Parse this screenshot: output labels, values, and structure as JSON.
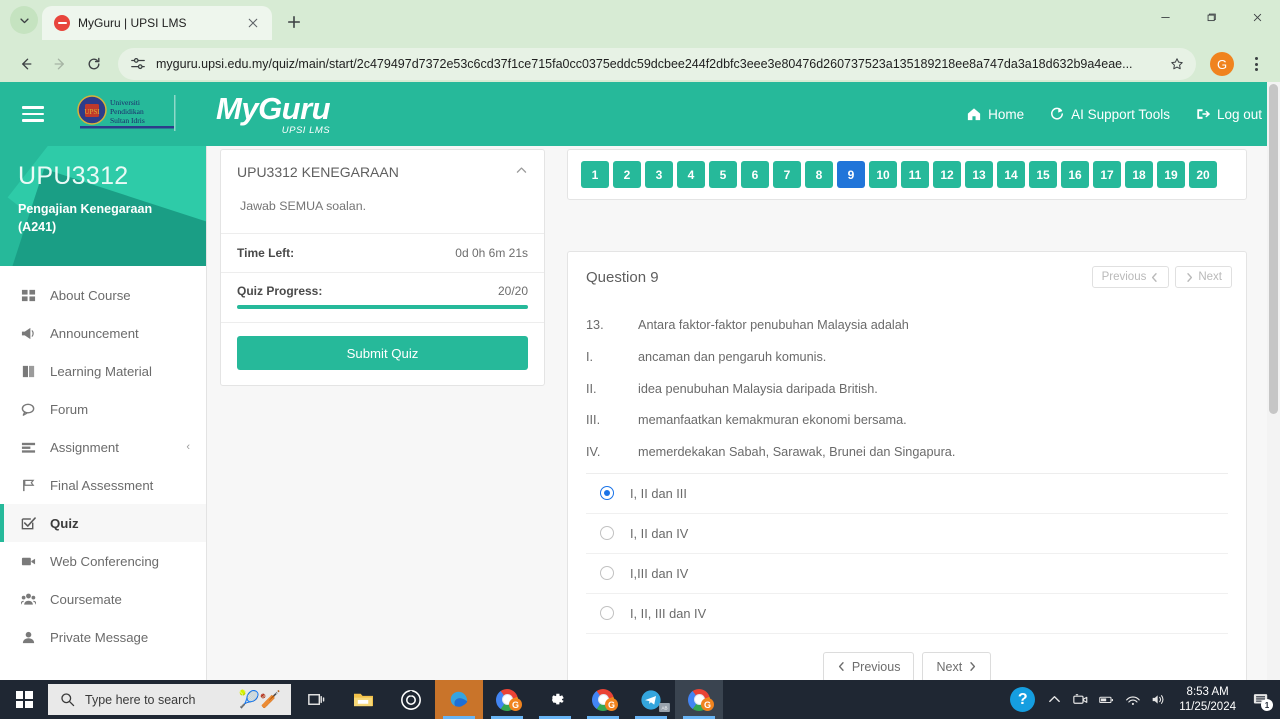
{
  "browser": {
    "tab": {
      "title": "MyGuru | UPSI LMS",
      "favicon": "record-icon"
    },
    "url": "myguru.upsi.edu.my/quiz/main/start/2c479497d7372e53c6cd37f1ce715fa0cc0375eddc59dcbee244f2dbfc3eee3e80476d260737523a135189218ee8a747da3a18d632b9a4eae...",
    "profile_initial": "G",
    "window_controls": {
      "minimize": "minimize-icon",
      "maximize": "restore-icon",
      "close": "close-icon"
    },
    "chrome_bg": "#d7ebd4"
  },
  "topnav": {
    "brand_main": "MyGuru",
    "brand_sub": "UPSI LMS",
    "links": [
      {
        "label": "Home",
        "icon": "home-icon"
      },
      {
        "label": "AI Support Tools",
        "icon": "ai-icon"
      },
      {
        "label": "Log out",
        "icon": "logout-icon"
      }
    ],
    "accent": "#26b99a"
  },
  "sidebar": {
    "course_code": "UPU3312",
    "course_name": "Pengajian Kenegaraan (A241)",
    "items": [
      {
        "label": "About Course",
        "icon": "grid-icon",
        "active": false,
        "caret": ""
      },
      {
        "label": "Announcement",
        "icon": "megaphone-icon",
        "active": false,
        "caret": ""
      },
      {
        "label": "Learning Material",
        "icon": "book-icon",
        "active": false,
        "caret": ""
      },
      {
        "label": "Forum",
        "icon": "chat-icon",
        "active": false,
        "caret": ""
      },
      {
        "label": "Assignment",
        "icon": "list-icon",
        "active": false,
        "caret": "‹"
      },
      {
        "label": "Final Assessment",
        "icon": "flag-icon",
        "active": false,
        "caret": ""
      },
      {
        "label": "Quiz",
        "icon": "checkbox-icon",
        "active": true,
        "caret": ""
      },
      {
        "label": "Web Conferencing",
        "icon": "video-icon",
        "active": false,
        "caret": ""
      },
      {
        "label": "Coursemate",
        "icon": "users-icon",
        "active": false,
        "caret": ""
      },
      {
        "label": "Private Message",
        "icon": "message-icon",
        "active": false,
        "caret": ""
      }
    ]
  },
  "quiz_info": {
    "title": "UPU3312 KENEGARAAN",
    "collapse_icon": "chevron-up-icon",
    "instruction": "Jawab SEMUA soalan.",
    "time_left_label": "Time Left:",
    "time_left_value": "0d 0h 6m 21s",
    "progress_label": "Quiz Progress:",
    "progress_value": "20/20",
    "progress_percent": 100,
    "submit_label": "Submit Quiz"
  },
  "question_nav": {
    "numbers": [
      1,
      2,
      3,
      4,
      5,
      6,
      7,
      8,
      9,
      10,
      11,
      12,
      13,
      14,
      15,
      16,
      17,
      18,
      19,
      20
    ],
    "current": 9,
    "answered_color": "#26b99a",
    "current_color": "#2175d9"
  },
  "question": {
    "heading": "Question 9",
    "top_prev_label": "Previous",
    "top_next_label": "Next",
    "stem_number": "13.",
    "stem_text": "Antara faktor-faktor penubuhan  Malaysia adalah",
    "statements": [
      {
        "mark": "I.",
        "text": "ancaman dan pengaruh komunis."
      },
      {
        "mark": "II.",
        "text": "idea penubuhan Malaysia daripada British."
      },
      {
        "mark": "III.",
        "text": "memanfaatkan kemakmuran ekonomi bersama."
      },
      {
        "mark": "IV.",
        "text": "memerdekakan Sabah, Sarawak, Brunei dan Singapura."
      }
    ],
    "options": [
      {
        "label": "I, II dan III",
        "selected": true
      },
      {
        "label": "I, II dan IV",
        "selected": false
      },
      {
        "label": "I,III dan IV",
        "selected": false
      },
      {
        "label": "I, II, III dan IV",
        "selected": false
      }
    ],
    "prev_label": "Previous",
    "next_label": "Next",
    "selected_radio_color": "#1a73e8"
  },
  "taskbar": {
    "search_placeholder": "Type here to search",
    "search_decoration": "🎾🏏",
    "items": [
      {
        "name": "cortana-icon"
      },
      {
        "name": "edge-icon"
      },
      {
        "name": "chrome-icon"
      },
      {
        "name": "settings-gear-icon"
      },
      {
        "name": "chrome-icon"
      },
      {
        "name": "telegram-icon"
      },
      {
        "name": "chrome-icon"
      }
    ],
    "tray": {
      "help_glyph": "?",
      "time": "8:53 AM",
      "date": "11/25/2024",
      "notification_count": "1"
    }
  }
}
